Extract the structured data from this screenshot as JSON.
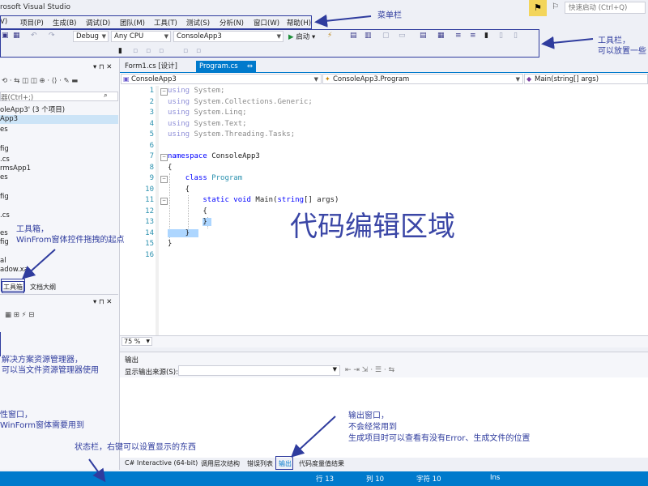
{
  "titlebar": {
    "title": "rosoft Visual Studio",
    "quick_launch_placeholder": "快速启动 (Ctrl+Q)"
  },
  "menu": [
    "V)",
    "项目(P)",
    "生成(B)",
    "调试(D)",
    "团队(M)",
    "工具(T)",
    "测试(S)",
    "分析(N)",
    "窗口(W)",
    "帮助(H)"
  ],
  "toolbar": {
    "config": "Debug",
    "platform": "Any CPU",
    "project": "ConsoleApp3",
    "start_label": "启动"
  },
  "solution_explorer": {
    "search_placeholder": "器(Ctrl+;)",
    "solution_label": "oleApp3' (3 个项目)",
    "items": [
      "App3",
      "es",
      "",
      "fig",
      ".cs",
      "rmsApp1",
      "es",
      "",
      "fig",
      "",
      ".cs",
      "",
      "es",
      "fig",
      "al",
      "adow.xa"
    ],
    "tab_toolbox": "工具箱",
    "tab_outline": "文档大纲"
  },
  "editor": {
    "tabs": [
      "Form1.cs [设计]",
      "Program.cs"
    ],
    "nav": [
      "ConsoleApp3",
      "ConsoleApp3.Program",
      "Main(string[] args)"
    ],
    "lines": [
      "using System;",
      "using System.Collections.Generic;",
      "using System.Linq;",
      "using System.Text;",
      "using System.Threading.Tasks;",
      "",
      "namespace ConsoleApp3",
      "{",
      "    class Program",
      "    {",
      "        static void Main(string[] args)",
      "        {",
      "        }",
      "    }",
      "}",
      ""
    ],
    "zoom": "75 %"
  },
  "output": {
    "title": "输出",
    "source_label": "显示输出来源(S):"
  },
  "bottom_tabs": [
    "C# Interactive (64-bit)",
    "调用层次结构",
    "错误列表",
    "输出",
    "代码度量值结果"
  ],
  "status": {
    "line": "行 13",
    "col": "列 10",
    "ch": "字符 10",
    "mode": "Ins"
  },
  "annotations": {
    "menubar": "菜单栏",
    "toolbar_l1": "工具栏，",
    "toolbar_l2": "可以放置一些",
    "code_area": "代码编辑区域",
    "toolbox_l1": "工具箱，",
    "toolbox_l2": "WinFrom窗体控件拖拽的起点",
    "explorer_l1": "解决方案资源管理器，",
    "explorer_l2": "可以当文件资源管理器使用",
    "props_l1": "性窗口，",
    "props_l2": "WinForm窗体需要用到",
    "output_l1": "输出窗口，",
    "output_l2": "不会经常用到",
    "output_l3": "生成项目时可以查看有没有Error、生成文件的位置",
    "statusbar": "状态栏，右键可以设置显示的东西"
  },
  "colors": {
    "accent": "#007acc",
    "annotation": "#2f3c9e",
    "keyword": "#0000ff",
    "type": "#2b91af",
    "selection": "#add6ff"
  }
}
